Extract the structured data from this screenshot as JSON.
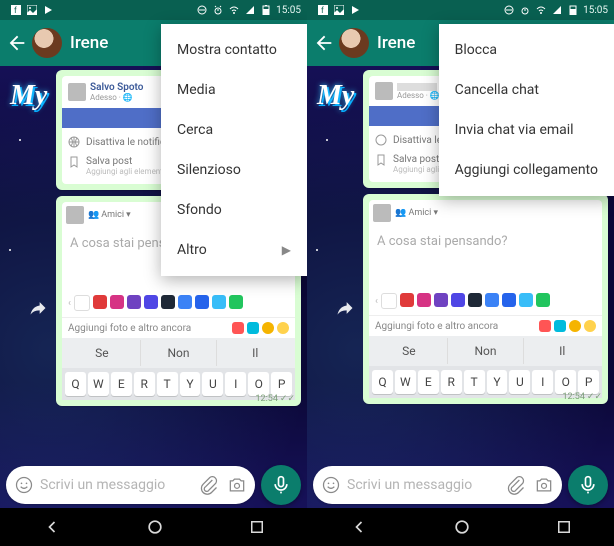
{
  "statusbar": {
    "time": "15:05"
  },
  "appbar": {
    "title": "Irene"
  },
  "bg_text": "My",
  "menu_left": {
    "items": [
      "Mostra contatto",
      "Media",
      "Cerca",
      "Silenzioso",
      "Sfondo",
      "Altro"
    ]
  },
  "menu_right": {
    "items": [
      "Blocca",
      "Cancella chat",
      "Invia chat via email",
      "Aggiungi collegamento"
    ]
  },
  "bubble1": {
    "fb_name": "Salvo Spoto",
    "fb_time": "Adesso",
    "notif": "Disattiva le notifiche per questo post",
    "save": "Salva post",
    "save_sub": "Aggiungi agli elementi salvati",
    "timestamp": "12:54"
  },
  "bubble2": {
    "friends": "Amici",
    "compose_placeholder": "A cosa stai pensando?",
    "attach": "Aggiungi foto e altro ancora",
    "palette": [
      "#ffffff",
      "#e03a3a",
      "#d63384",
      "#6f42c1",
      "#4f46e5",
      "#1f2937",
      "#3b82f6",
      "#2563eb",
      "#38bdf8",
      "#22c55e"
    ],
    "suggestions": [
      "Se",
      "Non",
      "Il"
    ],
    "keys": [
      "Q",
      "W",
      "E",
      "R",
      "T",
      "Y",
      "U",
      "I",
      "O",
      "P"
    ],
    "timestamp": "12:54"
  },
  "inputbar": {
    "placeholder": "Scrivi un messaggio"
  }
}
